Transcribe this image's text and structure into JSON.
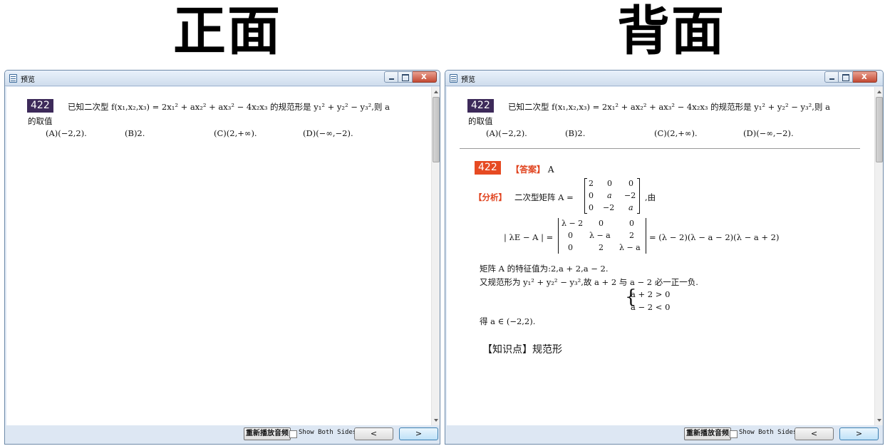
{
  "titles": {
    "front": "正面",
    "back": "背面"
  },
  "window": {
    "title": "预览",
    "replay_button": "重新播放音频",
    "show_both_label": "Show Both Sides",
    "prev_label": "<",
    "next_label": ">"
  },
  "question": {
    "number": "422",
    "line1": "已知二次型 f(x₁,x₂,x₃) = 2x₁² + ax₂² + ax₃² − 4x₂x₃ 的规范形是 y₁² + y₂² − y₃²,则 a",
    "line2": "的取值",
    "options": [
      "(A)(−2,2).",
      "(B)2.",
      "(C)(2,+∞).",
      "(D)(−∞,−2)."
    ]
  },
  "answer": {
    "number": "422",
    "label": "【答案】",
    "value": "A",
    "analysis_label": "【分析】",
    "matrix_intro": "二次型矩阵 A =",
    "matrix_suffix": ",由",
    "matrix_a": [
      [
        "2",
        "0",
        "0"
      ],
      [
        "0",
        "a",
        "−2"
      ],
      [
        "0",
        "−2",
        "a"
      ]
    ],
    "det_prefix": "| λE − A | =",
    "matrix_b": [
      [
        "λ − 2",
        "0",
        "0"
      ],
      [
        "0",
        "λ − a",
        "2"
      ],
      [
        "0",
        "2",
        "λ − a"
      ]
    ],
    "det_result": "= (λ − 2)(λ − a − 2)(λ − a + 2)",
    "eigen_line": "矩阵 A 的特征值为:2,a + 2,a − 2.",
    "norm_line": "又规范形为 y₁² + y₂² − y₃²,故 a + 2 与 a − 2 必一正一负.",
    "cond1": "a + 2 > 0",
    "cond2": "a − 2 < 0",
    "result_line": "得 a ∈ (−2,2).",
    "knowledge": "【知识点】规范形"
  }
}
